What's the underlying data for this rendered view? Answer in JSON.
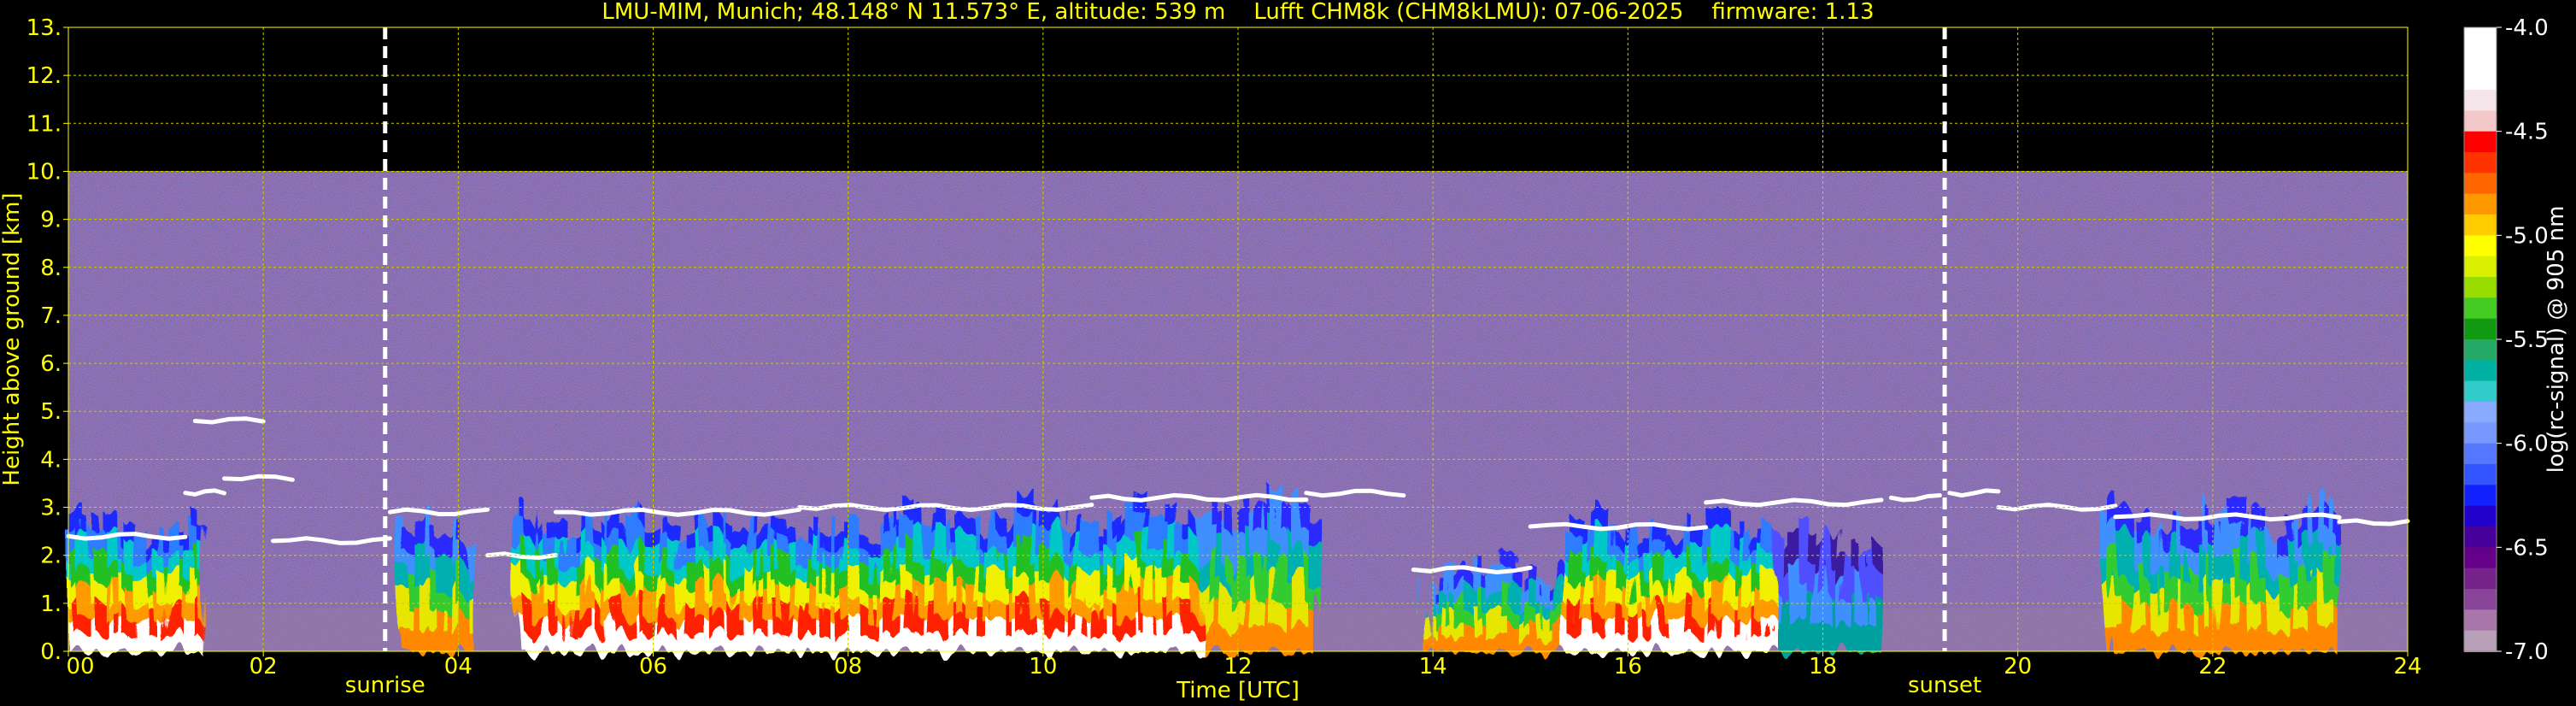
{
  "chart_data": {
    "type": "heatmap",
    "title": "LMU-MIM, Munich; 48.148° N 11.573° E, altitude: 539 m    Lufft CHM8k (CHM8kLMU): 07-06-2025    firmware: 1.13",
    "xlabel": "Time [UTC]",
    "ylabel": "Height above ground [km]",
    "x_range": [
      0,
      24
    ],
    "y_range": [
      0,
      13
    ],
    "x_ticks": [
      "00",
      "02",
      "04",
      "06",
      "08",
      "10",
      "12",
      "14",
      "16",
      "18",
      "20",
      "22",
      "24"
    ],
    "y_ticks": [
      "0.",
      "1.",
      "2.",
      "3.",
      "4.",
      "5.",
      "6.",
      "7.",
      "8.",
      "9.",
      "10.",
      "11.",
      "12.",
      "13."
    ],
    "grid": true,
    "data_ceiling_km": 10.0,
    "markers": [
      {
        "label": "sunrise",
        "time": 3.25
      },
      {
        "label": "sunset",
        "time": 19.25
      }
    ],
    "colorbar": {
      "label": "log(rc-signal) @ 905 nm",
      "range": [
        -7.0,
        -4.0
      ],
      "ticks": [
        "-4.0",
        "-4.5",
        "-5.0",
        "-5.5",
        "-6.0",
        "-6.5",
        "-7.0"
      ],
      "tick_values": [
        -4.0,
        -4.5,
        -5.0,
        -5.5,
        -6.0,
        -6.5,
        -7.0
      ]
    },
    "cloud_layers": [
      {
        "t_start": 0.0,
        "t_end": 1.2,
        "height_km": 2.4
      },
      {
        "t_start": 1.2,
        "t_end": 1.6,
        "height_km": 3.3
      },
      {
        "t_start": 1.6,
        "t_end": 2.3,
        "height_km": 3.6
      },
      {
        "t_start": 1.3,
        "t_end": 2.0,
        "height_km": 4.8
      },
      {
        "t_start": 2.1,
        "t_end": 3.3,
        "height_km": 2.3
      },
      {
        "t_start": 3.3,
        "t_end": 4.3,
        "height_km": 2.9
      },
      {
        "t_start": 4.3,
        "t_end": 5.0,
        "height_km": 2.0
      },
      {
        "t_start": 5.0,
        "t_end": 7.5,
        "height_km": 2.9
      },
      {
        "t_start": 7.5,
        "t_end": 10.5,
        "height_km": 3.0
      },
      {
        "t_start": 10.5,
        "t_end": 12.7,
        "height_km": 3.2
      },
      {
        "t_start": 12.7,
        "t_end": 13.7,
        "height_km": 3.3
      },
      {
        "t_start": 13.8,
        "t_end": 15.0,
        "height_km": 1.7
      },
      {
        "t_start": 15.0,
        "t_end": 16.8,
        "height_km": 2.6
      },
      {
        "t_start": 16.8,
        "t_end": 18.6,
        "height_km": 3.1
      },
      {
        "t_start": 18.7,
        "t_end": 19.2,
        "height_km": 3.2
      },
      {
        "t_start": 19.3,
        "t_end": 19.8,
        "height_km": 3.3
      },
      {
        "t_start": 19.8,
        "t_end": 21.0,
        "height_km": 3.0
      },
      {
        "t_start": 21.0,
        "t_end": 23.3,
        "height_km": 2.8
      },
      {
        "t_start": 23.3,
        "t_end": 24.0,
        "height_km": 2.7
      }
    ],
    "boundary_layer_segments": [
      {
        "t_start": 0.0,
        "t_end": 1.4,
        "top_km": 2.6,
        "intensity": "high"
      },
      {
        "t_start": 3.4,
        "t_end": 4.2,
        "top_km": 2.6,
        "intensity": "medium"
      },
      {
        "t_start": 4.6,
        "t_end": 7.8,
        "top_km": 2.7,
        "intensity": "high"
      },
      {
        "t_start": 7.8,
        "t_end": 11.6,
        "top_km": 2.8,
        "intensity": "high"
      },
      {
        "t_start": 11.6,
        "t_end": 12.8,
        "top_km": 3.1,
        "intensity": "medium"
      },
      {
        "t_start": 13.9,
        "t_end": 15.3,
        "top_km": 1.7,
        "intensity": "medium"
      },
      {
        "t_start": 15.3,
        "t_end": 17.5,
        "top_km": 2.6,
        "intensity": "high"
      },
      {
        "t_start": 17.5,
        "t_end": 18.6,
        "top_km": 2.4,
        "intensity": "low"
      },
      {
        "t_start": 20.9,
        "t_end": 23.3,
        "top_km": 2.8,
        "intensity": "medium"
      }
    ]
  }
}
